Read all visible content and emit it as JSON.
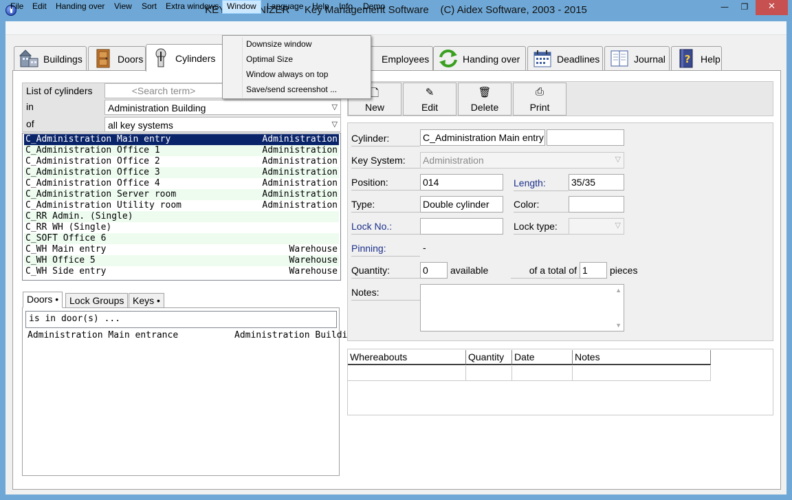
{
  "window": {
    "title": "KEY ORGANIZER  -  Key Management Software    (C) Aidex Software, 2003 - 2015",
    "min_glyph": "—",
    "max_glyph": "❐",
    "close_glyph": "✕"
  },
  "menu": [
    "File",
    "Edit",
    "Handing over",
    "View",
    "Sort",
    "Extra windows",
    "Window",
    "Language",
    "Help",
    "Info",
    "Demo"
  ],
  "window_menu": [
    "Downsize window",
    "Optimal Size",
    "Window always on top",
    "Save/send screenshot ..."
  ],
  "tabs": [
    {
      "label": "Buildings",
      "icon": "buildings-icon"
    },
    {
      "label": "Doors",
      "icon": "door-icon"
    },
    {
      "label": "Cylinders",
      "icon": "cylinder-icon"
    },
    {
      "label": "Employees",
      "icon": "employees-icon"
    },
    {
      "label": "Handing over",
      "icon": "handover-icon"
    },
    {
      "label": "Deadlines",
      "icon": "calendar-icon"
    },
    {
      "label": "Journal",
      "icon": "journal-icon"
    },
    {
      "label": "Help",
      "icon": "help-book-icon"
    }
  ],
  "list_panel": {
    "title_label": "List of cylinders",
    "search_placeholder": "<Search term>",
    "in_label": "in",
    "in_value": "Administration Building",
    "of_label": "of",
    "of_value": "all key systems"
  },
  "cylinders": [
    {
      "name": "C_Administration Main entry",
      "system": "Administration"
    },
    {
      "name": "C_Administration Office 1",
      "system": "Administration"
    },
    {
      "name": "C_Administration Office 2",
      "system": "Administration"
    },
    {
      "name": "C_Administration Office 3",
      "system": "Administration"
    },
    {
      "name": "C_Administration Office 4",
      "system": "Administration"
    },
    {
      "name": "C_Administration Server room",
      "system": "Administration"
    },
    {
      "name": "C_Administration Utility room",
      "system": "Administration"
    },
    {
      "name": "C_RR Admin. (Single)",
      "system": ""
    },
    {
      "name": "C_RR WH (Single)",
      "system": ""
    },
    {
      "name": "C_SOFT Office 6",
      "system": ""
    },
    {
      "name": "C_WH Main entry",
      "system": "Warehouse"
    },
    {
      "name": "C_WH Office 5",
      "system": "Warehouse"
    },
    {
      "name": "C_WH Side entry",
      "system": "Warehouse"
    }
  ],
  "subtabs": [
    "Doors •",
    "Lock Groups",
    "Keys •"
  ],
  "doors_panel": {
    "header": "is in door(s) ...",
    "door_name": "Administration Main entrance",
    "door_building": "Administration Building"
  },
  "toolbar": {
    "new": "New",
    "edit": "Edit",
    "delete": "Delete",
    "print": "Print"
  },
  "detail": {
    "cylinder_label": "Cylinder:",
    "cylinder_value": "C_Administration Main entry",
    "key_system_label": "Key System:",
    "key_system_value": "Administration",
    "position_label": "Position:",
    "position_value": "014",
    "length_label": "Length:",
    "length_value": "35/35",
    "type_label": "Type:",
    "type_value": "Double cylinder",
    "color_label": "Color:",
    "lock_no_label": "Lock No.:",
    "lock_type_label": "Lock type:",
    "pinning_label": "Pinning:",
    "pinning_value": "-",
    "quantity_label": "Quantity:",
    "quantity_value": "0",
    "available_label": "available",
    "total_label": "of a total of",
    "total_value": "1",
    "pieces_label": "pieces",
    "notes_label": "Notes:"
  },
  "whereabouts": {
    "columns": [
      "Whereabouts",
      "Quantity",
      "Date",
      "Notes"
    ]
  }
}
